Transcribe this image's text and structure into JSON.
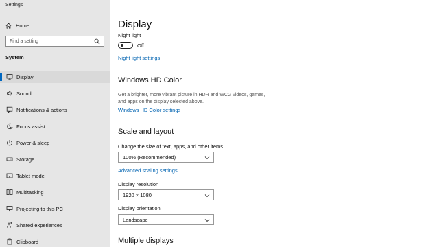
{
  "window": {
    "title": "Settings"
  },
  "sidebar": {
    "home_label": "Home",
    "search_placeholder": "Find a setting",
    "section_label": "System",
    "items": [
      {
        "label": "Display",
        "icon": "monitor-icon",
        "active": true
      },
      {
        "label": "Sound",
        "icon": "speaker-icon"
      },
      {
        "label": "Notifications & actions",
        "icon": "notification-icon"
      },
      {
        "label": "Focus assist",
        "icon": "moon-icon"
      },
      {
        "label": "Power & sleep",
        "icon": "power-icon"
      },
      {
        "label": "Storage",
        "icon": "storage-icon"
      },
      {
        "label": "Tablet mode",
        "icon": "tablet-icon"
      },
      {
        "label": "Multitasking",
        "icon": "multitasking-icon"
      },
      {
        "label": "Projecting to this PC",
        "icon": "projector-icon"
      },
      {
        "label": "Shared experiences",
        "icon": "shared-icon"
      },
      {
        "label": "Clipboard",
        "icon": "clipboard-icon"
      }
    ]
  },
  "main": {
    "title": "Display",
    "night_light": {
      "label": "Night light",
      "state": "Off",
      "link": "Night light settings"
    },
    "hd_color": {
      "heading": "Windows HD Color",
      "description": "Get a brighter, more vibrant picture in HDR and WCG videos, games, and apps on the display selected above.",
      "link": "Windows HD Color settings"
    },
    "scale_layout": {
      "heading": "Scale and layout",
      "scale_label": "Change the size of text, apps, and other items",
      "scale_value": "100% (Recommended)",
      "advanced_link": "Advanced scaling settings",
      "resolution_label": "Display resolution",
      "resolution_value": "1920 × 1080",
      "orientation_label": "Display orientation",
      "orientation_value": "Landscape"
    },
    "multiple_displays": {
      "heading": "Multiple displays"
    }
  },
  "colors": {
    "accent": "#0067c0",
    "link": "#0063b1",
    "sidebar_bg": "#e6e6e6"
  }
}
